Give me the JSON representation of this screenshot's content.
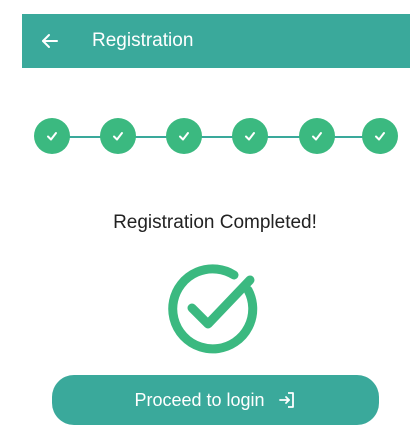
{
  "header": {
    "title": "Registration",
    "back_icon": "arrow-left-icon"
  },
  "stepper": {
    "steps": [
      {
        "state": "completed",
        "icon": "check-icon"
      },
      {
        "state": "completed",
        "icon": "check-icon"
      },
      {
        "state": "completed",
        "icon": "check-icon"
      },
      {
        "state": "completed",
        "icon": "check-icon"
      },
      {
        "state": "completed",
        "icon": "check-icon"
      },
      {
        "state": "completed",
        "icon": "check-icon"
      }
    ]
  },
  "status": {
    "message": "Registration Completed!",
    "icon": "success-check-icon"
  },
  "cta": {
    "label": "Proceed to login",
    "icon": "login-icon"
  },
  "colors": {
    "primary": "#3aa99b",
    "success": "#3bb980",
    "text": "#222222",
    "on_primary": "#ffffff"
  }
}
